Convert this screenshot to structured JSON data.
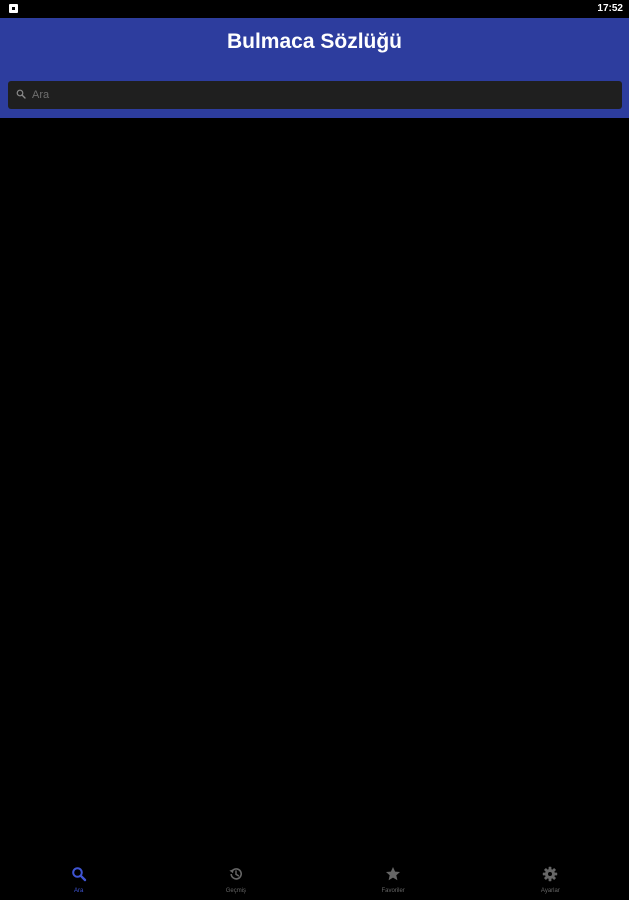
{
  "status_bar": {
    "time": "17:52"
  },
  "app_bar": {
    "title": "Bulmaca Sözlüğü"
  },
  "search": {
    "placeholder": "Ara",
    "value": ""
  },
  "bottom_nav": {
    "items": [
      {
        "label": "Ara",
        "icon": "search-icon",
        "active": true
      },
      {
        "label": "Geçmiş",
        "icon": "history-icon",
        "active": false
      },
      {
        "label": "Favoriler",
        "icon": "star-icon",
        "active": false
      },
      {
        "label": "Ayarlar",
        "icon": "gear-icon",
        "active": false
      }
    ]
  },
  "colors": {
    "app_bar": "#2d3d9e",
    "background": "#000000",
    "search_box": "#1f1f1f",
    "nav_active": "#3f55d4",
    "nav_inactive": "#666666"
  }
}
